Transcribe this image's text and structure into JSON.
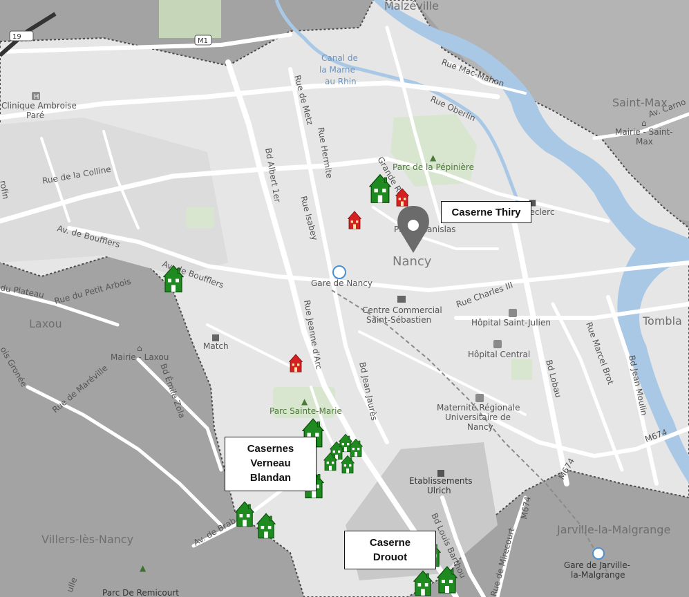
{
  "map": {
    "city": "Nancy",
    "places": {
      "malzeville": "Malzéville",
      "saint_max": "Saint-Max",
      "laxou": "Laxou",
      "villers": "Villers-lès-Nancy",
      "jarville": "Jarville-la-Malgrange",
      "tomblaine": "Tombla"
    },
    "roads": {
      "n19": "19",
      "m1": "M1",
      "rue_de_metz": "Rue de Metz",
      "rue_hermite": "Rue Hermite",
      "bd_albert": "Bd Albert 1er",
      "rue_isabey": "Rue Isabey",
      "rue_colline": "Rue de la Colline",
      "av_boufflers_1": "Av. de Boufflers",
      "av_boufflers_2": "Av. de Boufflers",
      "rue_plateau": "du Plateau",
      "rue_petit_arbois": "Rue du Petit Arbois",
      "rue_mac_mahon": "Rue Mac-Mahon",
      "rue_oberlin": "Rue Oberlin",
      "av_carnot": "Av. Carno",
      "grande_rue": "Grande Ru",
      "rue_jeanne": "Rue Jeanne d'Arc",
      "bd_jean_jaures": "Bd Jean Jaurès",
      "rue_charles": "Rue Charles III",
      "bd_lobau": "Bd Lobau",
      "rue_marcel_brot": "Rue Marcel Brot",
      "bd_jean_moulin": "Bd Jean Moulin",
      "rue_mareville": "Rue de Maréville",
      "bd_emile_zola": "Bd Émile Zola",
      "rois_gronee": "ois Gronée",
      "av_brabois": "Av. de Brab",
      "bd_louis_barthou": "Bd Louis Barthou",
      "rue_mirecourt": "Rue de Mirecourt",
      "m674_a": "M674",
      "m674_b": "M674",
      "m674_c": "M674",
      "ulle": "ulle",
      "ofin": "rofin"
    },
    "pois": {
      "clinique": [
        "Clinique Ambroise",
        "Paré"
      ],
      "canal": [
        "Canal de",
        "la Marne",
        "au Rhin"
      ],
      "pepiniere": "Parc de la Pépinière",
      "mairie_saint_max": [
        "Mairie - Saint-",
        "Max"
      ],
      "stanislas": "Place Stanislas",
      "leclerc": "Leclerc",
      "gare": "Gare de Nancy",
      "centre_commercial": [
        "Centre Commercial",
        "Saint-Sébastien"
      ],
      "hopital_saint_julien": "Hôpital Saint-Julien",
      "hopital_central": "Hôpital Central",
      "match": "Match",
      "mairie_laxou": "Mairie - Laxou",
      "parc_sainte_marie": "Parc Sainte-Marie",
      "maternite": [
        "Maternité Régionale",
        "Universitaire de",
        "Nancy"
      ],
      "ulrich": [
        "Etablissements",
        "Ulrich"
      ],
      "gare_jarville": [
        "Gare de Jarville-",
        "la-Malgrange"
      ],
      "parc_remicourt": "Parc De Remicourt"
    }
  },
  "callouts": {
    "thiry": [
      "Caserne Thiry"
    ],
    "verneau": [
      "Casernes",
      "Verneau",
      "Blandan"
    ],
    "drouot": [
      "Caserne",
      "Drouot"
    ]
  },
  "colors": {
    "green_house": "#1f8a1f",
    "red_house": "#d42020",
    "marker": "#6b6b6b",
    "road": "#ffffff",
    "water": "#a9c8e6"
  },
  "icons": {
    "green": "green-house-icon",
    "red": "red-house-icon",
    "pin": "location-pin-icon"
  }
}
